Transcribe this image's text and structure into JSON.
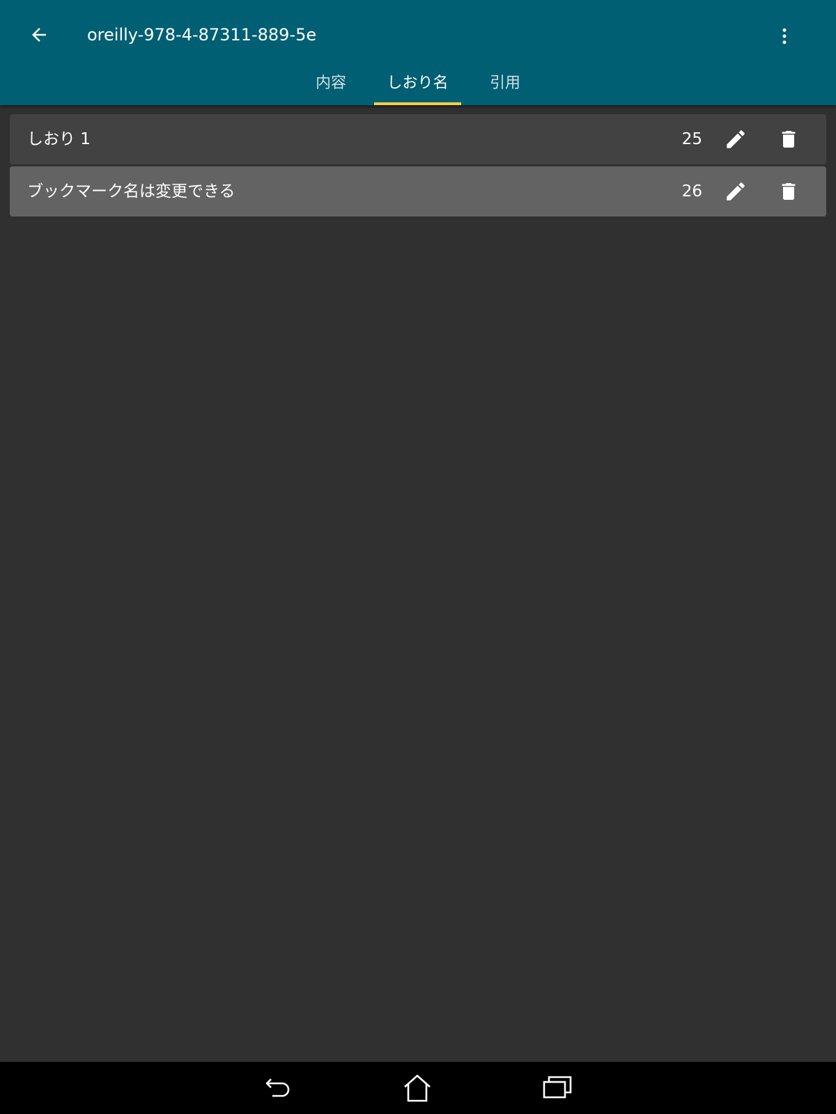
{
  "app_bar": {
    "title": "oreilly-978-4-87311-889-5e",
    "back_icon": "arrow-left-icon",
    "more_icon": "more-vertical-icon",
    "background": "#005f73"
  },
  "tabs": [
    {
      "label": "内容",
      "active": false
    },
    {
      "label": "しおり名",
      "active": true
    },
    {
      "label": "引用",
      "active": false
    }
  ],
  "tab_indicator_color": "#f4d03f",
  "bookmarks": [
    {
      "label": "しおり 1",
      "page": "25",
      "background": "#424242",
      "edit_icon": "pencil-icon",
      "delete_icon": "trash-icon"
    },
    {
      "label": "ブックマーク名は変更できる",
      "page": "26",
      "background": "#636363",
      "edit_icon": "pencil-icon",
      "delete_icon": "trash-icon"
    }
  ],
  "nav_bar": {
    "back_icon": "nav-back-icon",
    "home_icon": "nav-home-icon",
    "recents_icon": "nav-recents-icon"
  }
}
